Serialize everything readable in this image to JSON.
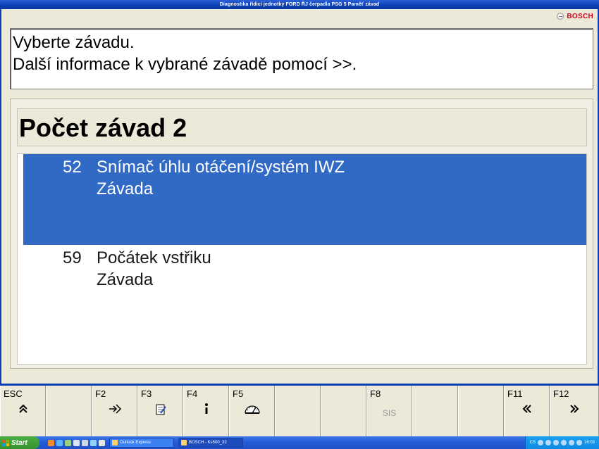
{
  "window": {
    "title": "Diagnostika řídicí jednotky  FORD  ŘJ čerpadla PSG 5  Paměť závad",
    "brand": "BOSCH"
  },
  "info": {
    "line1": "Vyberte závadu.",
    "line2": "Další informace k vybrané  závadě pomocí >>."
  },
  "faults": {
    "heading": "Počet závad 2",
    "items": [
      {
        "code": "52",
        "name": "Snímač úhlu otáčení/systém IWZ",
        "status": "Závada",
        "selected": true
      },
      {
        "code": "59",
        "name": "Počátek vstřiku",
        "status": "Závada",
        "selected": false
      }
    ]
  },
  "function_keys": [
    {
      "label": "ESC",
      "icon": "double-up-chevron-icon",
      "glyph": "︽"
    },
    {
      "label": "",
      "icon": "",
      "glyph": ""
    },
    {
      "label": "F2",
      "icon": "arrow-into-icon",
      "glyph": "⟐"
    },
    {
      "label": "F3",
      "icon": "notepad-edit-icon",
      "glyph": "✎"
    },
    {
      "label": "F4",
      "icon": "info-icon",
      "glyph": "ℹ"
    },
    {
      "label": "F5",
      "icon": "gauge-icon",
      "glyph": "⏲"
    },
    {
      "label": "",
      "icon": "",
      "glyph": ""
    },
    {
      "label": "",
      "icon": "",
      "glyph": ""
    },
    {
      "label": "F8",
      "icon": "sis-text",
      "glyph": "SIS"
    },
    {
      "label": "",
      "icon": "",
      "glyph": ""
    },
    {
      "label": "",
      "icon": "",
      "glyph": ""
    },
    {
      "label": "F11",
      "icon": "double-left-chevron-icon",
      "glyph": "«"
    },
    {
      "label": "F12",
      "icon": "double-right-chevron-icon",
      "glyph": "»"
    }
  ],
  "taskbar": {
    "start_label": "Start",
    "tasks": [
      {
        "label": "Outlook Express",
        "active": false
      },
      {
        "label": "BOSCH - Ks500_32",
        "active": true
      }
    ],
    "language": "CS",
    "clock": "16:03"
  },
  "colors": {
    "selection": "#316ac5",
    "titlebar": "#0b3fb4",
    "brand_red": "#d0021b"
  }
}
